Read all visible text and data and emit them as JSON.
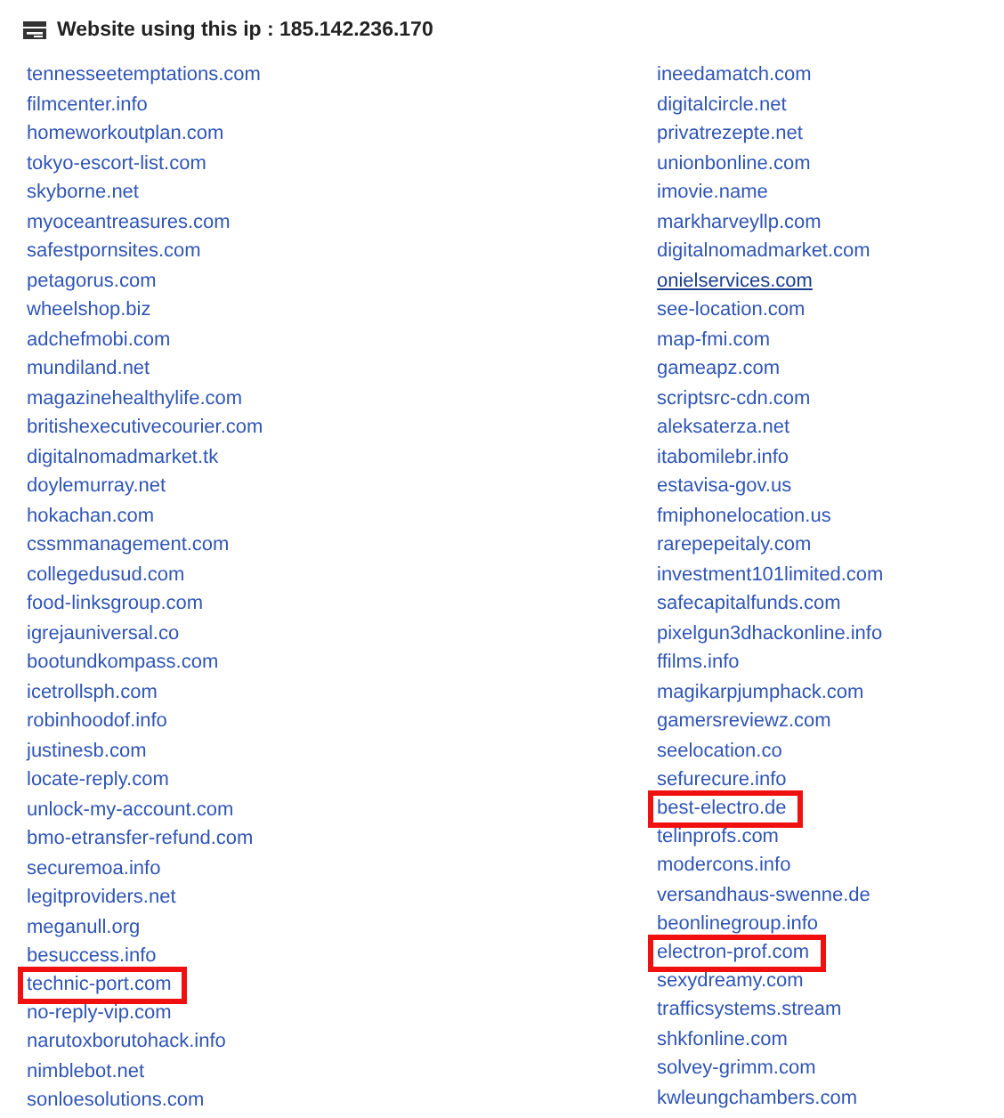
{
  "header": {
    "title": "Website using this ip : 185.142.236.170"
  },
  "columns": [
    {
      "items": [
        {
          "label": "tennesseetemptations.com",
          "highlighted": false,
          "hovered": false
        },
        {
          "label": "filmcenter.info",
          "highlighted": false,
          "hovered": false
        },
        {
          "label": "homeworkoutplan.com",
          "highlighted": false,
          "hovered": false
        },
        {
          "label": "tokyo-escort-list.com",
          "highlighted": false,
          "hovered": false
        },
        {
          "label": "skyborne.net",
          "highlighted": false,
          "hovered": false
        },
        {
          "label": "myoceantreasures.com",
          "highlighted": false,
          "hovered": false
        },
        {
          "label": "safestpornsites.com",
          "highlighted": false,
          "hovered": false
        },
        {
          "label": "petagorus.com",
          "highlighted": false,
          "hovered": false
        },
        {
          "label": "wheelshop.biz",
          "highlighted": false,
          "hovered": false
        },
        {
          "label": "adchefmobi.com",
          "highlighted": false,
          "hovered": false
        },
        {
          "label": "mundiland.net",
          "highlighted": false,
          "hovered": false
        },
        {
          "label": "magazinehealthylife.com",
          "highlighted": false,
          "hovered": false
        },
        {
          "label": "britishexecutivecourier.com",
          "highlighted": false,
          "hovered": false
        },
        {
          "label": "digitalnomadmarket.tk",
          "highlighted": false,
          "hovered": false
        },
        {
          "label": "doylemurray.net",
          "highlighted": false,
          "hovered": false
        },
        {
          "label": "hokachan.com",
          "highlighted": false,
          "hovered": false
        },
        {
          "label": "cssmmanagement.com",
          "highlighted": false,
          "hovered": false
        },
        {
          "label": "collegedusud.com",
          "highlighted": false,
          "hovered": false
        },
        {
          "label": "food-linksgroup.com",
          "highlighted": false,
          "hovered": false
        },
        {
          "label": "igrejauniversal.co",
          "highlighted": false,
          "hovered": false
        },
        {
          "label": "bootundkompass.com",
          "highlighted": false,
          "hovered": false
        },
        {
          "label": "icetrollsph.com",
          "highlighted": false,
          "hovered": false
        },
        {
          "label": "robinhoodof.info",
          "highlighted": false,
          "hovered": false
        },
        {
          "label": "justinesb.com",
          "highlighted": false,
          "hovered": false
        },
        {
          "label": "locate-reply.com",
          "highlighted": false,
          "hovered": false
        },
        {
          "label": "unlock-my-account.com",
          "highlighted": false,
          "hovered": false
        },
        {
          "label": "bmo-etransfer-refund.com",
          "highlighted": false,
          "hovered": false
        },
        {
          "label": "securemoa.info",
          "highlighted": false,
          "hovered": false
        },
        {
          "label": "legitproviders.net",
          "highlighted": false,
          "hovered": false
        },
        {
          "label": "meganull.org",
          "highlighted": false,
          "hovered": false
        },
        {
          "label": "besuccess.info",
          "highlighted": false,
          "hovered": false
        },
        {
          "label": "technic-port.com",
          "highlighted": true,
          "hovered": false
        },
        {
          "label": "no-reply-vip.com",
          "highlighted": false,
          "hovered": false
        },
        {
          "label": "narutoxborutohack.info",
          "highlighted": false,
          "hovered": false
        },
        {
          "label": "nimblebot.net",
          "highlighted": false,
          "hovered": false
        },
        {
          "label": "sonloesolutions.com",
          "highlighted": false,
          "hovered": false
        }
      ]
    },
    {
      "items": [
        {
          "label": "ineedamatch.com",
          "highlighted": false,
          "hovered": false
        },
        {
          "label": "digitalcircle.net",
          "highlighted": false,
          "hovered": false
        },
        {
          "label": "privatrezepte.net",
          "highlighted": false,
          "hovered": false
        },
        {
          "label": "unionbonline.com",
          "highlighted": false,
          "hovered": false
        },
        {
          "label": "imovie.name",
          "highlighted": false,
          "hovered": false
        },
        {
          "label": "markharveyllp.com",
          "highlighted": false,
          "hovered": false
        },
        {
          "label": "digitalnomadmarket.com",
          "highlighted": false,
          "hovered": false
        },
        {
          "label": "onielservices.com",
          "highlighted": false,
          "hovered": true
        },
        {
          "label": "see-location.com",
          "highlighted": false,
          "hovered": false
        },
        {
          "label": "map-fmi.com",
          "highlighted": false,
          "hovered": false
        },
        {
          "label": "gameapz.com",
          "highlighted": false,
          "hovered": false
        },
        {
          "label": "scriptsrc-cdn.com",
          "highlighted": false,
          "hovered": false
        },
        {
          "label": "aleksaterza.net",
          "highlighted": false,
          "hovered": false
        },
        {
          "label": "itabomilebr.info",
          "highlighted": false,
          "hovered": false
        },
        {
          "label": "estavisa-gov.us",
          "highlighted": false,
          "hovered": false
        },
        {
          "label": "fmiphonelocation.us",
          "highlighted": false,
          "hovered": false
        },
        {
          "label": "rarepepeitaly.com",
          "highlighted": false,
          "hovered": false
        },
        {
          "label": "investment101limited.com",
          "highlighted": false,
          "hovered": false
        },
        {
          "label": "safecapitalfunds.com",
          "highlighted": false,
          "hovered": false
        },
        {
          "label": "pixelgun3dhackonline.info",
          "highlighted": false,
          "hovered": false
        },
        {
          "label": "ffilms.info",
          "highlighted": false,
          "hovered": false
        },
        {
          "label": "magikarpjumphack.com",
          "highlighted": false,
          "hovered": false
        },
        {
          "label": "gamersreviewz.com",
          "highlighted": false,
          "hovered": false
        },
        {
          "label": "seelocation.co",
          "highlighted": false,
          "hovered": false
        },
        {
          "label": "sefurecure.info",
          "highlighted": false,
          "hovered": false
        },
        {
          "label": "best-electro.de",
          "highlighted": true,
          "hovered": false
        },
        {
          "label": "telinprofs.com",
          "highlighted": false,
          "hovered": false
        },
        {
          "label": "modercons.info",
          "highlighted": false,
          "hovered": false
        },
        {
          "label": "versandhaus-swenne.de",
          "highlighted": false,
          "hovered": false
        },
        {
          "label": "beonlinegroup.info",
          "highlighted": false,
          "hovered": false
        },
        {
          "label": "electron-prof.com",
          "highlighted": true,
          "hovered": false
        },
        {
          "label": "sexydreamy.com",
          "highlighted": false,
          "hovered": false
        },
        {
          "label": "trafficsystems.stream",
          "highlighted": false,
          "hovered": false
        },
        {
          "label": "shkfonline.com",
          "highlighted": false,
          "hovered": false
        },
        {
          "label": "solvey-grimm.com",
          "highlighted": false,
          "hovered": false
        },
        {
          "label": "kwleungchambers.com",
          "highlighted": false,
          "hovered": false
        }
      ]
    }
  ]
}
